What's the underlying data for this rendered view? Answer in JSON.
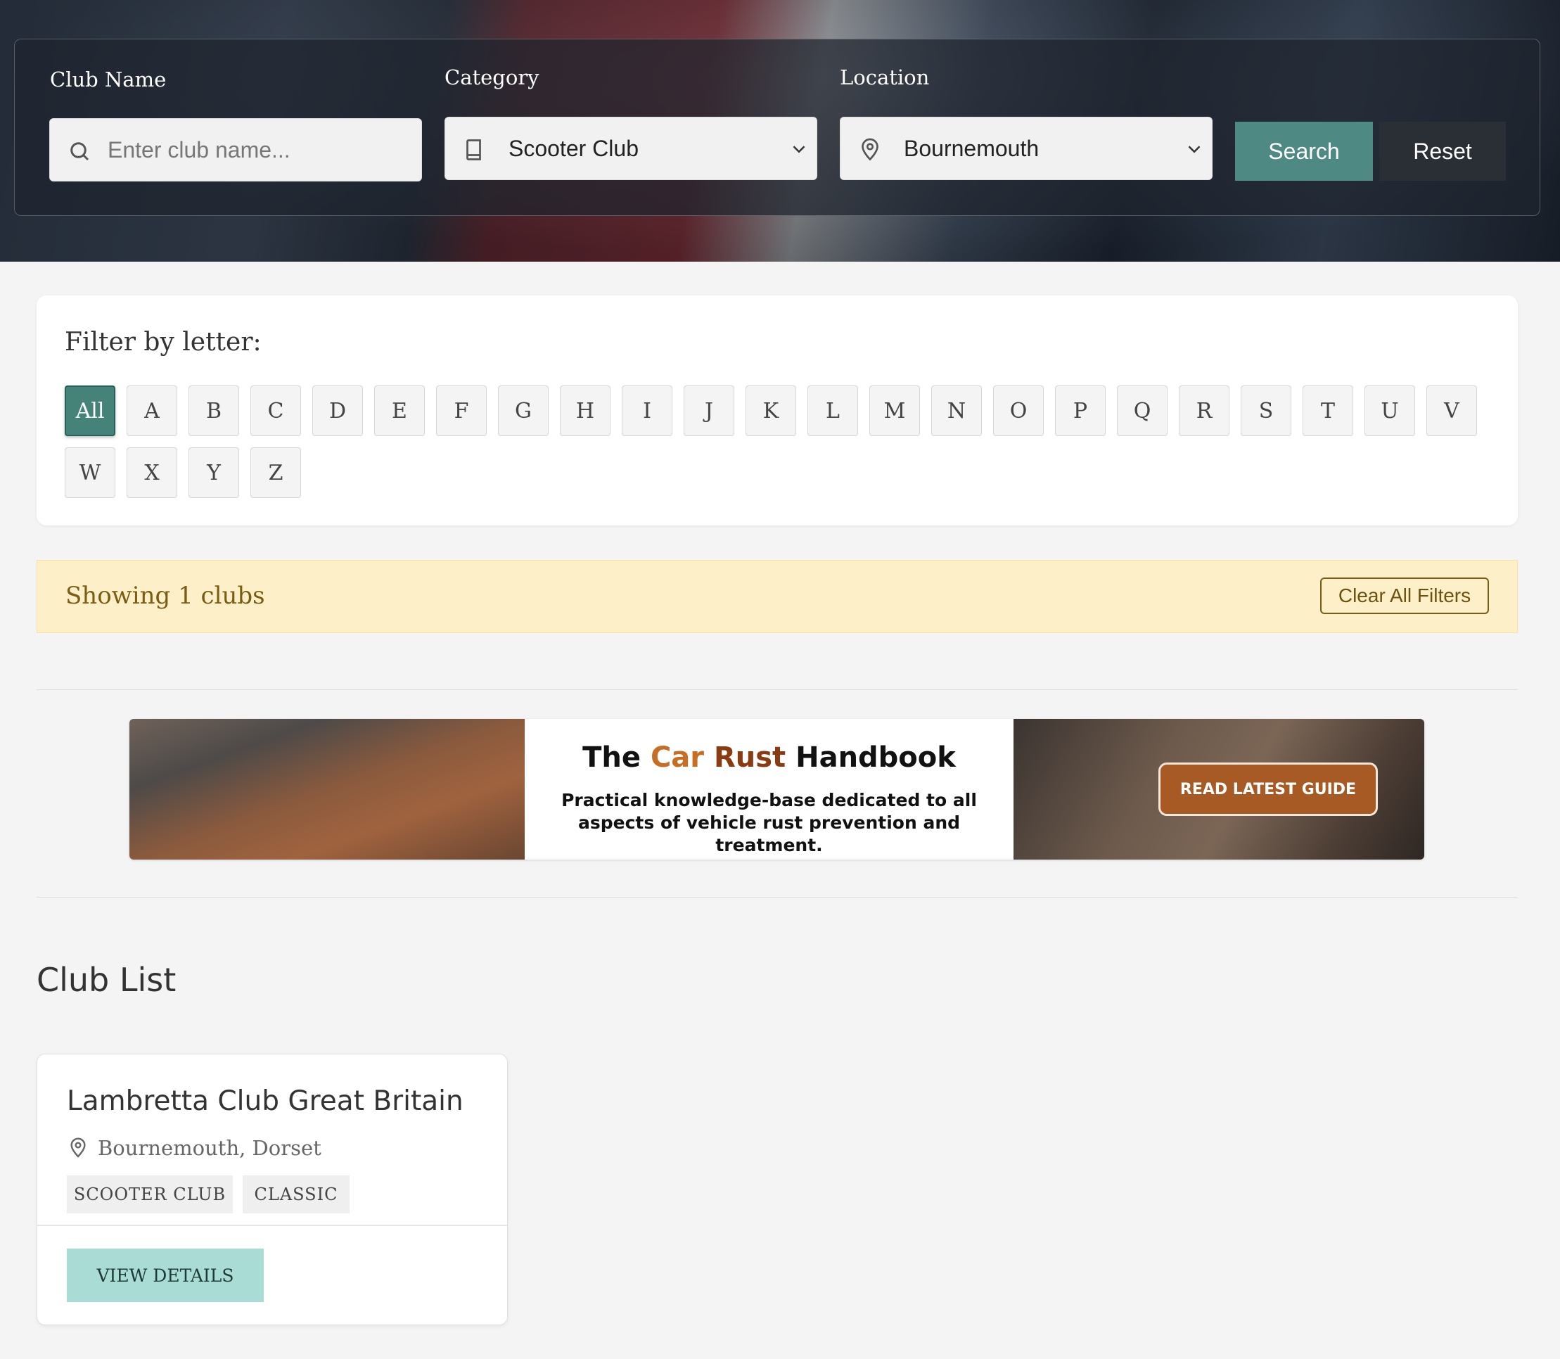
{
  "search": {
    "club_name_label": "Club Name",
    "club_name_placeholder": "Enter club name...",
    "category_label": "Category",
    "category_value": "Scooter Club",
    "location_label": "Location",
    "location_value": "Bournemouth",
    "search_button": "Search",
    "reset_button": "Reset"
  },
  "letter_filter": {
    "title": "Filter by letter:",
    "letters": [
      "All",
      "A",
      "B",
      "C",
      "D",
      "E",
      "F",
      "G",
      "H",
      "I",
      "J",
      "K",
      "L",
      "M",
      "N",
      "O",
      "P",
      "Q",
      "R",
      "S",
      "T",
      "U",
      "V",
      "W",
      "X",
      "Y",
      "Z"
    ],
    "active": "All"
  },
  "status": {
    "text": "Showing 1 clubs",
    "clear_button": "Clear All Filters"
  },
  "ad": {
    "title_part1": "The ",
    "title_part2": "Car",
    "title_part3": " Rust",
    "title_part4": " Handbook",
    "description": "Practical knowledge-base dedicated to all aspects of vehicle rust prevention and treatment.",
    "cta": "READ LATEST GUIDE"
  },
  "club_list": {
    "heading": "Club List",
    "clubs": [
      {
        "name": "Lambretta Club Great Britain",
        "location": "Bournemouth, Dorset",
        "tags": [
          "SCOOTER CLUB",
          "CLASSIC"
        ],
        "button": "VIEW DETAILS"
      }
    ]
  },
  "colors": {
    "accent": "#4e8a83",
    "active_letter": "#458378",
    "status_bg": "#fdf0c9",
    "cta": "#a85a25",
    "view_details": "#a8dcd4"
  }
}
